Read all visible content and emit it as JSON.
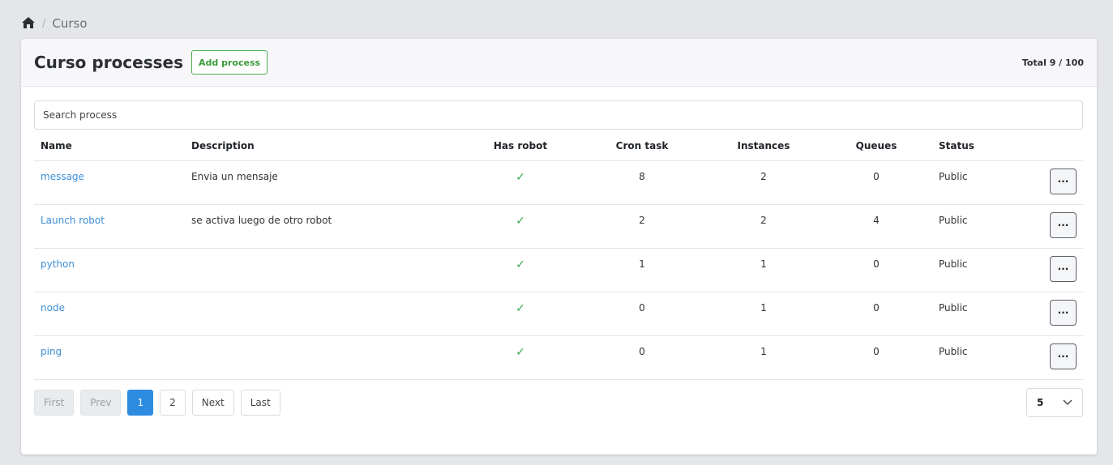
{
  "breadcrumb": {
    "separator": "/",
    "current": "Curso"
  },
  "header": {
    "title": "Curso processes",
    "add_label": "Add process",
    "total": "Total 9 / 100"
  },
  "search": {
    "placeholder": "Search process",
    "value": ""
  },
  "table": {
    "columns": [
      "Name",
      "Description",
      "Has robot",
      "Cron task",
      "Instances",
      "Queues",
      "Status"
    ],
    "rows": [
      {
        "name": "message",
        "description": "Envia un mensaje",
        "has_robot": "✓",
        "cron": "8",
        "instances": "2",
        "queues": "0",
        "status": "Public",
        "actions": "···"
      },
      {
        "name": "Launch robot",
        "description": "se activa luego de otro robot",
        "has_robot": "✓",
        "cron": "2",
        "instances": "2",
        "queues": "4",
        "status": "Public",
        "actions": "···"
      },
      {
        "name": "python",
        "description": "",
        "has_robot": "✓",
        "cron": "1",
        "instances": "1",
        "queues": "0",
        "status": "Public",
        "actions": "···"
      },
      {
        "name": "node",
        "description": "",
        "has_robot": "✓",
        "cron": "0",
        "instances": "1",
        "queues": "0",
        "status": "Public",
        "actions": "···"
      },
      {
        "name": "ping",
        "description": "",
        "has_robot": "✓",
        "cron": "0",
        "instances": "1",
        "queues": "0",
        "status": "Public",
        "actions": "···"
      }
    ]
  },
  "pagination": {
    "first": "First",
    "prev": "Prev",
    "pages": [
      "1",
      "2"
    ],
    "next": "Next",
    "last": "Last",
    "current_page": "1"
  },
  "per_page": {
    "value": "5"
  },
  "colors": {
    "accent": "#2d8ce0",
    "link": "#3d8fd6",
    "success": "#3aa845"
  }
}
